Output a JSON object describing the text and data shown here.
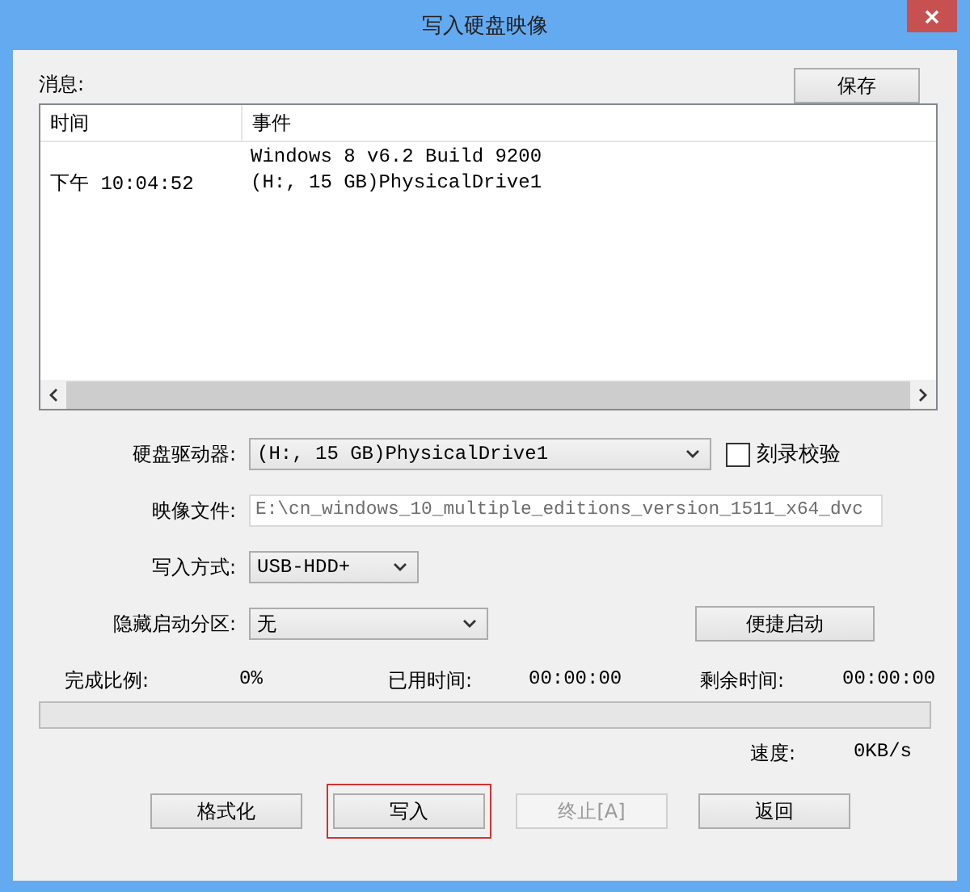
{
  "window": {
    "title": "写入硬盘映像"
  },
  "messages": {
    "label": "消息:",
    "save_button": {
      "label": "保存"
    },
    "columns": [
      "时间",
      "事件"
    ],
    "rows": [
      {
        "event": "Windows 8 v6.2 Build 9200"
      },
      {
        "time": "下午 10:04:52",
        "event": "(H:, 15 GB)PhysicalDrive1"
      }
    ]
  },
  "form": [
    {
      "kind": "select",
      "label": "硬盘驱动器:",
      "value": "(H:, 15 GB)PhysicalDrive1",
      "checkbox": {
        "label": "刻录校验",
        "checked": false
      }
    },
    {
      "kind": "field",
      "label": "映像文件:",
      "value": "E:\\cn_windows_10_multiple_editions_version_1511_x64_dvc"
    },
    {
      "kind": "select",
      "label": "写入方式:",
      "value": "USB-HDD+"
    },
    {
      "kind": "select",
      "label": "隐藏启动分区:",
      "value": "无",
      "button": {
        "label": "便捷启动"
      }
    }
  ],
  "progress": {
    "done_label": "完成比例:",
    "done_value": "0%",
    "elapsed_label": "已用时间:",
    "elapsed_value": "00:00:00",
    "remaining_label": "剩余时间:",
    "remaining_value": "00:00:00",
    "level": 0,
    "speed_label": "速度:",
    "speed_value": "0KB/s"
  },
  "buttons": [
    {
      "label": "格式化",
      "disabled": false,
      "highlighted": false
    },
    {
      "label": "写入",
      "disabled": false,
      "highlighted": true
    },
    {
      "label": "终止[A]",
      "disabled": true,
      "highlighted": false
    },
    {
      "label": "返回",
      "disabled": false,
      "highlighted": false
    }
  ]
}
